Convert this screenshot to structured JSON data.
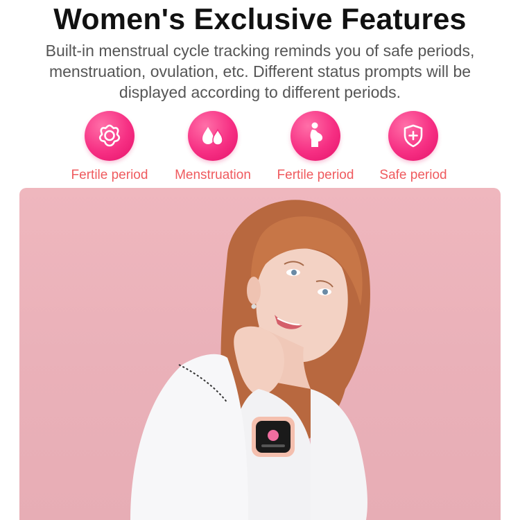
{
  "heading": "Women's Exclusive Features",
  "description": "Built-in menstrual cycle tracking reminds you of safe periods, menstruation, ovulation, etc. Different status prompts will be displayed according to different periods.",
  "features": [
    {
      "label": "Fertile period",
      "icon": "flower-icon"
    },
    {
      "label": "Menstruation",
      "icon": "droplets-icon"
    },
    {
      "label": "Fertile period",
      "icon": "pregnant-woman-icon"
    },
    {
      "label": "Safe period",
      "icon": "shield-plus-icon"
    }
  ],
  "colors": {
    "accent": "#f62f83",
    "label": "#ef5a5e",
    "background_photo": "#eab1b9"
  }
}
